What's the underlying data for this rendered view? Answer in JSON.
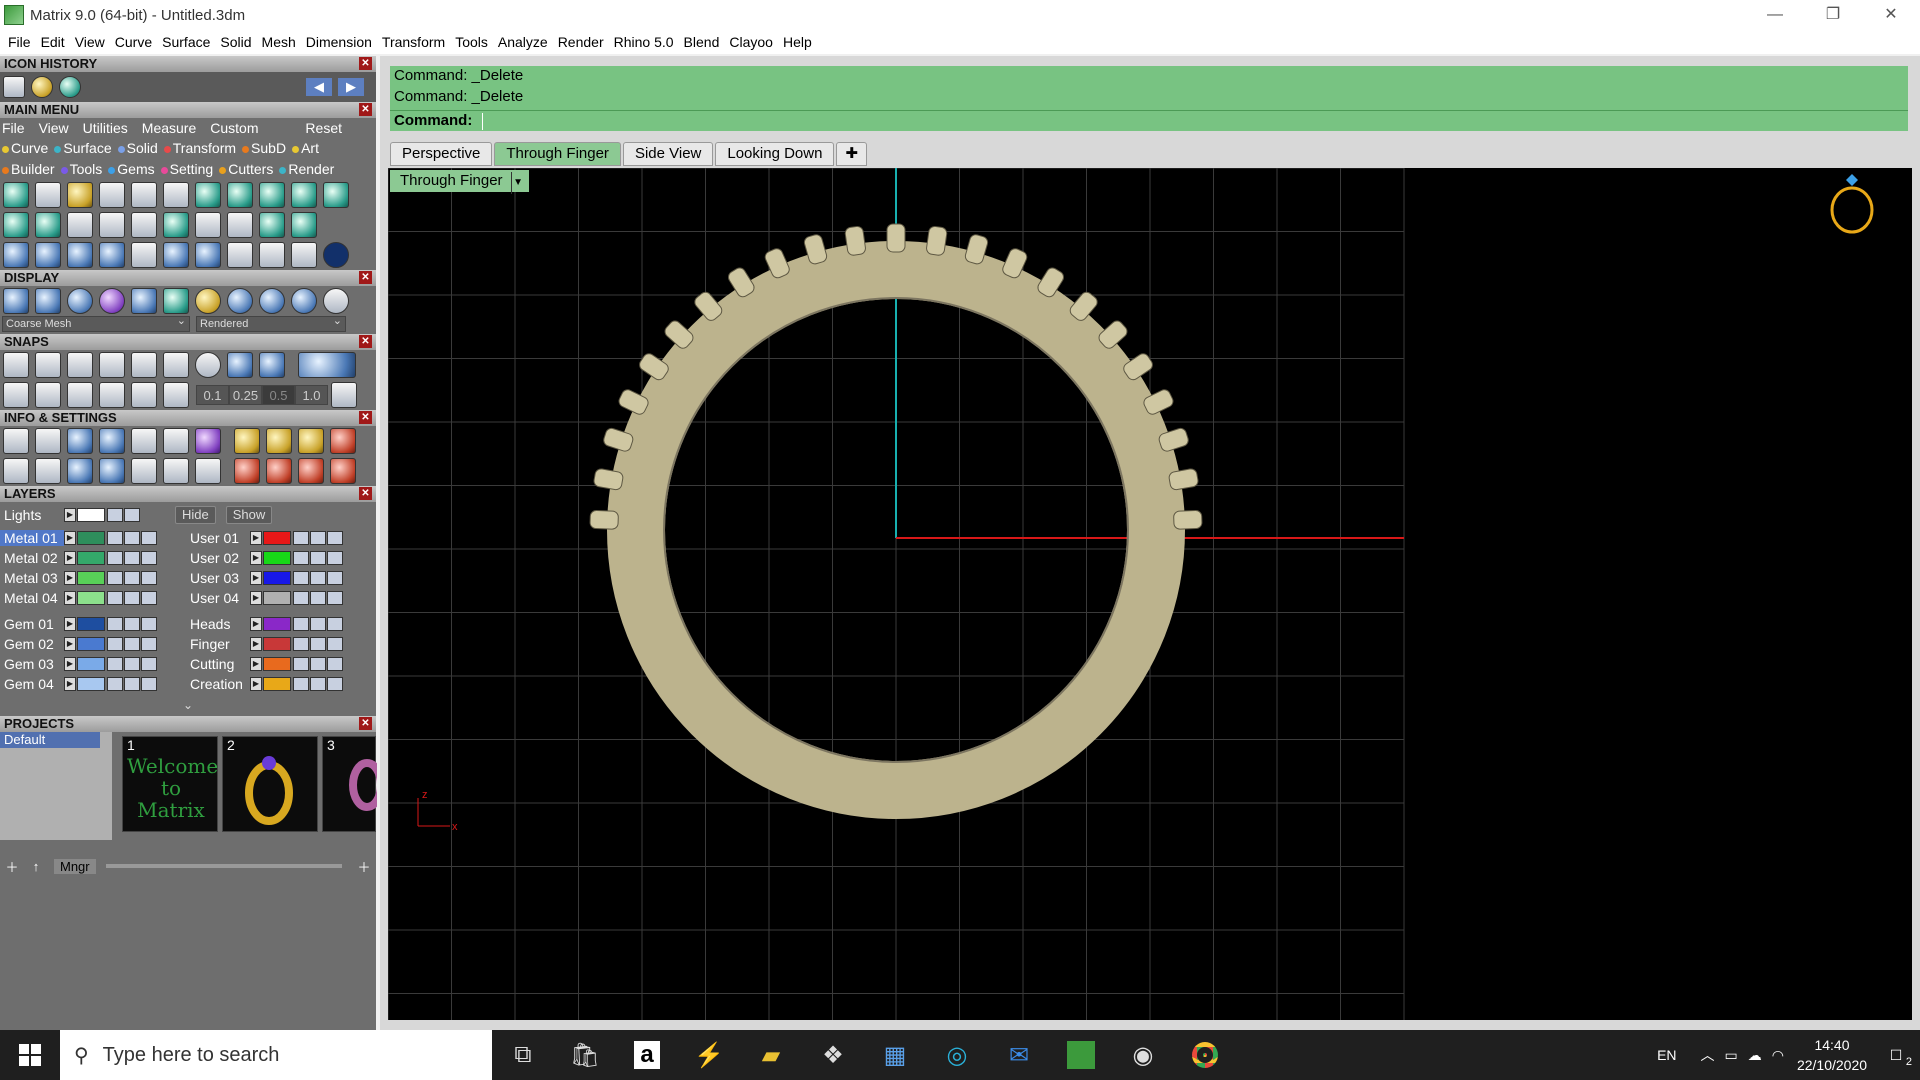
{
  "window": {
    "title": "Matrix 9.0 (64-bit) - Untitled.3dm",
    "controls": [
      "—",
      "❐",
      "✕"
    ]
  },
  "menubar": [
    "File",
    "Edit",
    "View",
    "Curve",
    "Surface",
    "Solid",
    "Mesh",
    "Dimension",
    "Transform",
    "Tools",
    "Analyze",
    "Render",
    "Rhino 5.0",
    "Blend",
    "Clayoo",
    "Help"
  ],
  "left": {
    "icon_history": "ICON HISTORY",
    "main_menu": "MAIN MENU",
    "main_menu_file": [
      "File",
      "View",
      "Utilities",
      "Measure",
      "Custom"
    ],
    "main_menu_reset": "Reset",
    "main_menu_tabs1": [
      {
        "label": "Curve",
        "color": "#e8c832"
      },
      {
        "label": "Surface",
        "color": "#3cb4c8"
      },
      {
        "label": "Solid",
        "color": "#7aa0e8"
      },
      {
        "label": "Transform",
        "color": "#e84a4a"
      },
      {
        "label": "SubD",
        "color": "#e87a1e"
      },
      {
        "label": "Art",
        "color": "#e8c832"
      }
    ],
    "main_menu_tabs2": [
      {
        "label": "Builder",
        "color": "#e87a1e"
      },
      {
        "label": "Tools",
        "color": "#7a5ae8"
      },
      {
        "label": "Gems",
        "color": "#3ca0e8"
      },
      {
        "label": "Setting",
        "color": "#e84a9a"
      },
      {
        "label": "Cutters",
        "color": "#e8a01e"
      },
      {
        "label": "Render",
        "color": "#3cb4c8"
      }
    ],
    "display": "DISPLAY",
    "display_mesh": "Coarse Mesh",
    "display_mode": "Rendered",
    "snaps": "SNAPS",
    "snap_values": [
      "0.1",
      "0.25",
      "0.5",
      "1.0"
    ],
    "info_settings": "INFO & SETTINGS",
    "layers_title": "LAYERS",
    "lights": "Lights",
    "hide": "Hide",
    "show": "Show",
    "layers_left": [
      {
        "name": "Metal 01",
        "color": "#2e8e5c",
        "selected": true
      },
      {
        "name": "Metal 02",
        "color": "#34a86a",
        "selected": false
      },
      {
        "name": "Metal 03",
        "color": "#58d058",
        "selected": false
      },
      {
        "name": "Metal 04",
        "color": "#8ce08c",
        "selected": false
      },
      {
        "name": "Gem 01",
        "color": "#1e4ea0",
        "selected": false
      },
      {
        "name": "Gem 02",
        "color": "#4a7ad0",
        "selected": false
      },
      {
        "name": "Gem 03",
        "color": "#7aaae8",
        "selected": false
      },
      {
        "name": "Gem 04",
        "color": "#a8c8f0",
        "selected": false
      }
    ],
    "layers_right": [
      {
        "name": "User 01",
        "color": "#e81818"
      },
      {
        "name": "User 02",
        "color": "#18d818"
      },
      {
        "name": "User 03",
        "color": "#1818e8"
      },
      {
        "name": "User 04",
        "color": "#b0b0b0"
      },
      {
        "name": "Heads",
        "color": "#8a28c8"
      },
      {
        "name": "Finger",
        "color": "#c83838"
      },
      {
        "name": "Cutting",
        "color": "#e86a1e"
      },
      {
        "name": "Creation",
        "color": "#e8a818"
      }
    ],
    "projects_title": "PROJECTS",
    "project_default": "Default",
    "thumbs": [
      "1",
      "2",
      "3"
    ],
    "welcome": "Welcome to Matrix",
    "mngr": "Mngr"
  },
  "command": {
    "history": [
      "Command: _Delete",
      "Command: _Delete"
    ],
    "prompt": "Command:"
  },
  "viewtabs": [
    "Perspective",
    "Through Finger",
    "Side View",
    "Looking Down"
  ],
  "viewtab_active": "Through Finger",
  "viewport_label": "Through Finger",
  "axes": {
    "x": "x",
    "z": "z"
  },
  "taskbar": {
    "search_placeholder": "Type here to search",
    "language": "EN",
    "time": "14:40",
    "date": "22/10/2020",
    "notifications": "2"
  },
  "colors": {
    "command_bg": "#78c382",
    "axis_x": "#d81818",
    "axis_y": "#18b0b0",
    "ring": "#b8b08a"
  }
}
